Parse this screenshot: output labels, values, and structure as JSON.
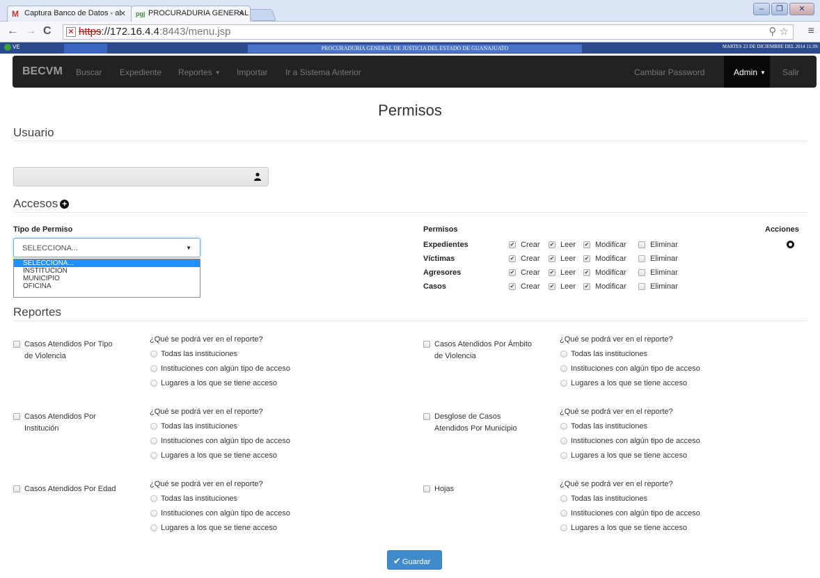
{
  "browser": {
    "tabs": [
      {
        "title": "Captura Banco de Datos - al",
        "icon": "gmail-icon"
      },
      {
        "title": "PROCURADURIA GENERAL D",
        "icon": "site-icon"
      }
    ],
    "url": {
      "scheme": "https",
      "host": "://172.16.4.4",
      "path": ":8443/menu.jsp"
    }
  },
  "app_header": {
    "version_label": "VE",
    "title": "PROCURADURIA GENERAL DE JUSTICIA DEL ESTADO DE GUANAJUATO",
    "date": "MARTES 23 DE DICIEMBRE DEL 2014 11:39:"
  },
  "navbar": {
    "brand": "BECVM",
    "items": [
      "Buscar",
      "Expediente",
      "Reportes",
      "Importar",
      "Ir a Sistema Anterior"
    ],
    "right": {
      "change_password": "Cambiar Password",
      "admin": "Admin",
      "logout": "Salir"
    }
  },
  "page": {
    "title": "Permisos",
    "usuario_heading": "Usuario",
    "user_value": "",
    "accesos_heading": "Accesos",
    "tipo_permiso_label": "Tipo de Permiso",
    "select_value": "SELECCIONA...",
    "select_options": [
      "SELECCIONA...",
      "INSTITUCIÓN",
      "MUNICIPIO",
      "OFICINA"
    ],
    "permisos_label": "Permisos",
    "acciones_label": "Acciones",
    "permission_rows": [
      {
        "name": "Expedientes",
        "crear": true,
        "leer": true,
        "modificar": true,
        "eliminar": false
      },
      {
        "name": "Víctimas",
        "crear": true,
        "leer": true,
        "modificar": true,
        "eliminar": false
      },
      {
        "name": "Agresores",
        "crear": true,
        "leer": true,
        "modificar": true,
        "eliminar": false
      },
      {
        "name": "Casos",
        "crear": true,
        "leer": true,
        "modificar": true,
        "eliminar": false
      }
    ],
    "perm_labels": {
      "crear": "Crear",
      "leer": "Leer",
      "modificar": "Modificar",
      "eliminar": "Eliminar"
    },
    "reportes_heading": "Reportes",
    "report_question": "¿Qué se podrá ver en el reporte?",
    "report_options": [
      "Todas las instituciones",
      "Instituciones con algún tipo de acceso",
      "Lugares a los que se tiene acceso"
    ],
    "reports": [
      {
        "label_lines": [
          "Casos Atendidos Por Tipo",
          "de Violencia"
        ]
      },
      {
        "label_lines": [
          "Casos Atendidos Por Ámbito",
          "de Violencia"
        ]
      },
      {
        "label_lines": [
          "Casos Atendidos Por",
          "Institución"
        ]
      },
      {
        "label_lines": [
          "Desglose de Casos",
          "Atendidos Por Municipio"
        ]
      },
      {
        "label_lines": [
          "Casos Atendidos Por Edad"
        ]
      },
      {
        "label_lines": [
          "Hojas"
        ]
      }
    ],
    "save_label": "Guardar"
  }
}
